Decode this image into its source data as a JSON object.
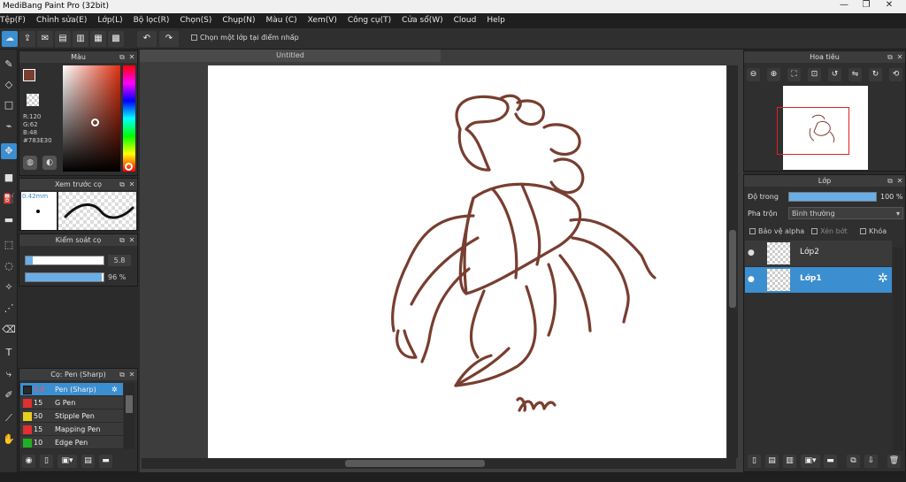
{
  "window": {
    "title": "MediBang Paint Pro (32bit)"
  },
  "menu": [
    "Tệp(F)",
    "Chỉnh sửa(E)",
    "Lớp(L)",
    "Bộ lọc(R)",
    "Chọn(S)",
    "Chụp(N)",
    "Màu (C)",
    "Xem(V)",
    "Công cụ(T)",
    "Cửa sổ(W)",
    "Cloud",
    "Help"
  ],
  "toolbar": {
    "select_layer_label": "Chọn một lớp tại điểm nhấp"
  },
  "color_panel": {
    "title": "Màu",
    "r": "R:120",
    "g": "G:62",
    "b": "B:48",
    "hex": "#783E30",
    "accent": "#783E30"
  },
  "brush_preview": {
    "title": "Xem trước cọ",
    "size": "0.42mm"
  },
  "brush_control": {
    "title": "Kiểm soát cọ",
    "size_value": "5.8",
    "opacity_value": "96 %"
  },
  "brush_list": {
    "title": "Cọ: Pen (Sharp)",
    "items": [
      {
        "size": "5.8",
        "name": "Pen (Sharp)",
        "color": "#2a2a2a"
      },
      {
        "size": "15",
        "name": "G Pen",
        "color": "#e03030"
      },
      {
        "size": "50",
        "name": "Stipple Pen",
        "color": "#e8d020"
      },
      {
        "size": "15",
        "name": "Mapping Pen",
        "color": "#e03030"
      },
      {
        "size": "10",
        "name": "Edge Pen",
        "color": "#20b020"
      }
    ]
  },
  "document": {
    "tab": "Untitled",
    "signature": "Nai"
  },
  "navigator": {
    "title": "Hoa tiêu"
  },
  "layers": {
    "title": "Lớp",
    "opacity_label": "Độ trong",
    "opacity_value": "100 %",
    "blend_label": "Pha trộn",
    "blend_value": "Bình thường",
    "protect_alpha": "Bảo vệ alpha",
    "clipping": "Xén bớt",
    "lock": "Khóa",
    "items": [
      {
        "name": "Lớp2",
        "selected": false
      },
      {
        "name": "Lớp1",
        "selected": true
      }
    ]
  }
}
